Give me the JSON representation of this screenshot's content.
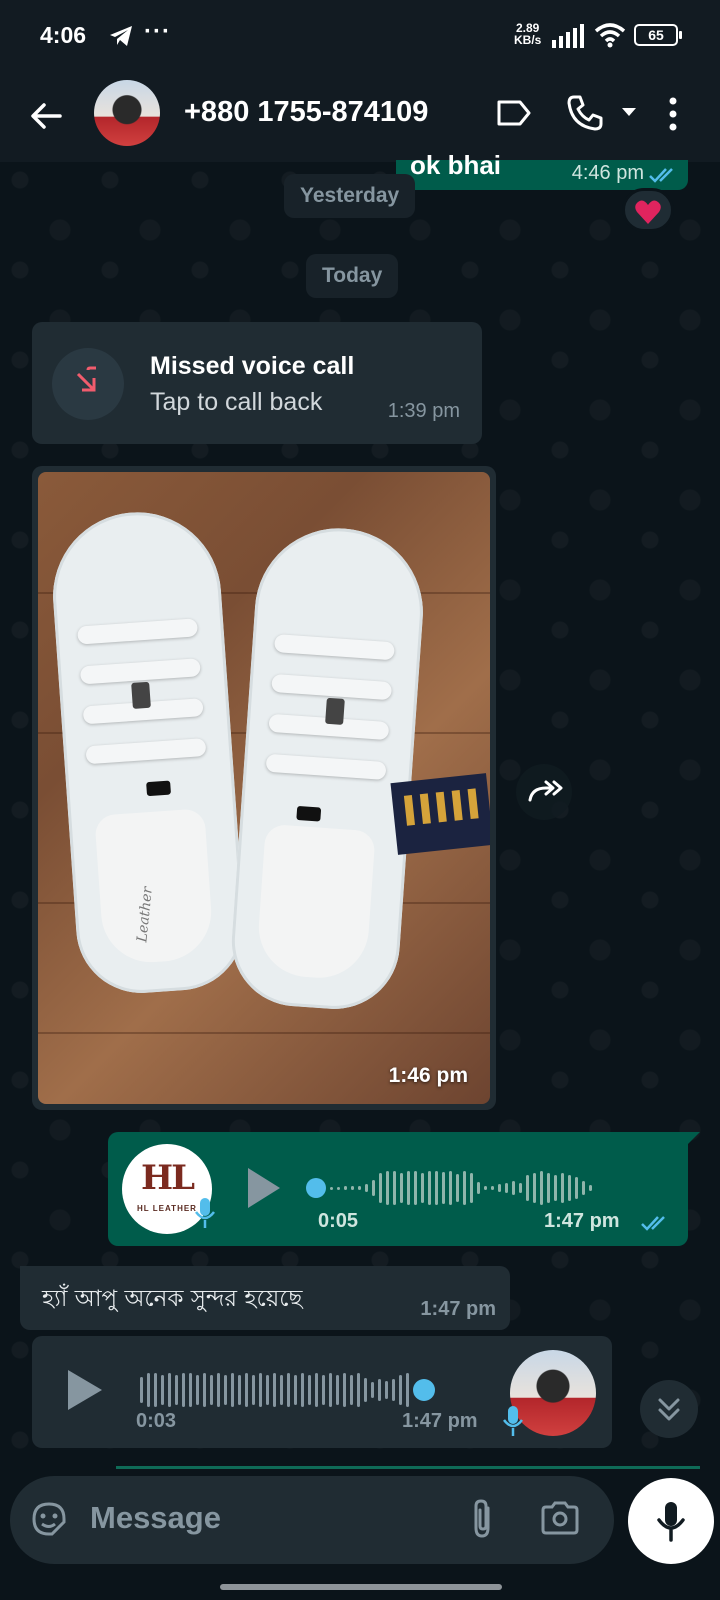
{
  "status_bar": {
    "time": "4:06",
    "more": "···",
    "speed_value": "2.89",
    "speed_unit": "KB/s",
    "battery": "65"
  },
  "header": {
    "contact": "+880 1755-874109"
  },
  "messages": {
    "partial": {
      "text": "ok bhai",
      "time": "4:46 pm",
      "reaction": "❤️"
    },
    "date_yesterday": "Yesterday",
    "date_today": "Today",
    "missed_call": {
      "title": "Missed voice call",
      "subtitle": "Tap to call back",
      "time": "1:39 pm"
    },
    "image": {
      "time": "1:46 pm",
      "shoe_brand": "Leather"
    },
    "voice_out": {
      "logo_mark": "HL",
      "logo_text": "HL LEATHER",
      "duration": "0:05",
      "time": "1:47 pm"
    },
    "text_in": {
      "text": "হ্যাঁ আপু অনেক সুন্দর হয়েছে",
      "time": "1:47 pm"
    },
    "voice_in": {
      "duration": "0:03",
      "time": "1:47 pm"
    }
  },
  "composer": {
    "placeholder": "Message"
  },
  "colors": {
    "background": "#0b141a",
    "incoming_bubble": "#202c33",
    "outgoing_bubble": "#005c4b",
    "accent_blue": "#53bdeb",
    "missed_red": "#f15c6d"
  }
}
